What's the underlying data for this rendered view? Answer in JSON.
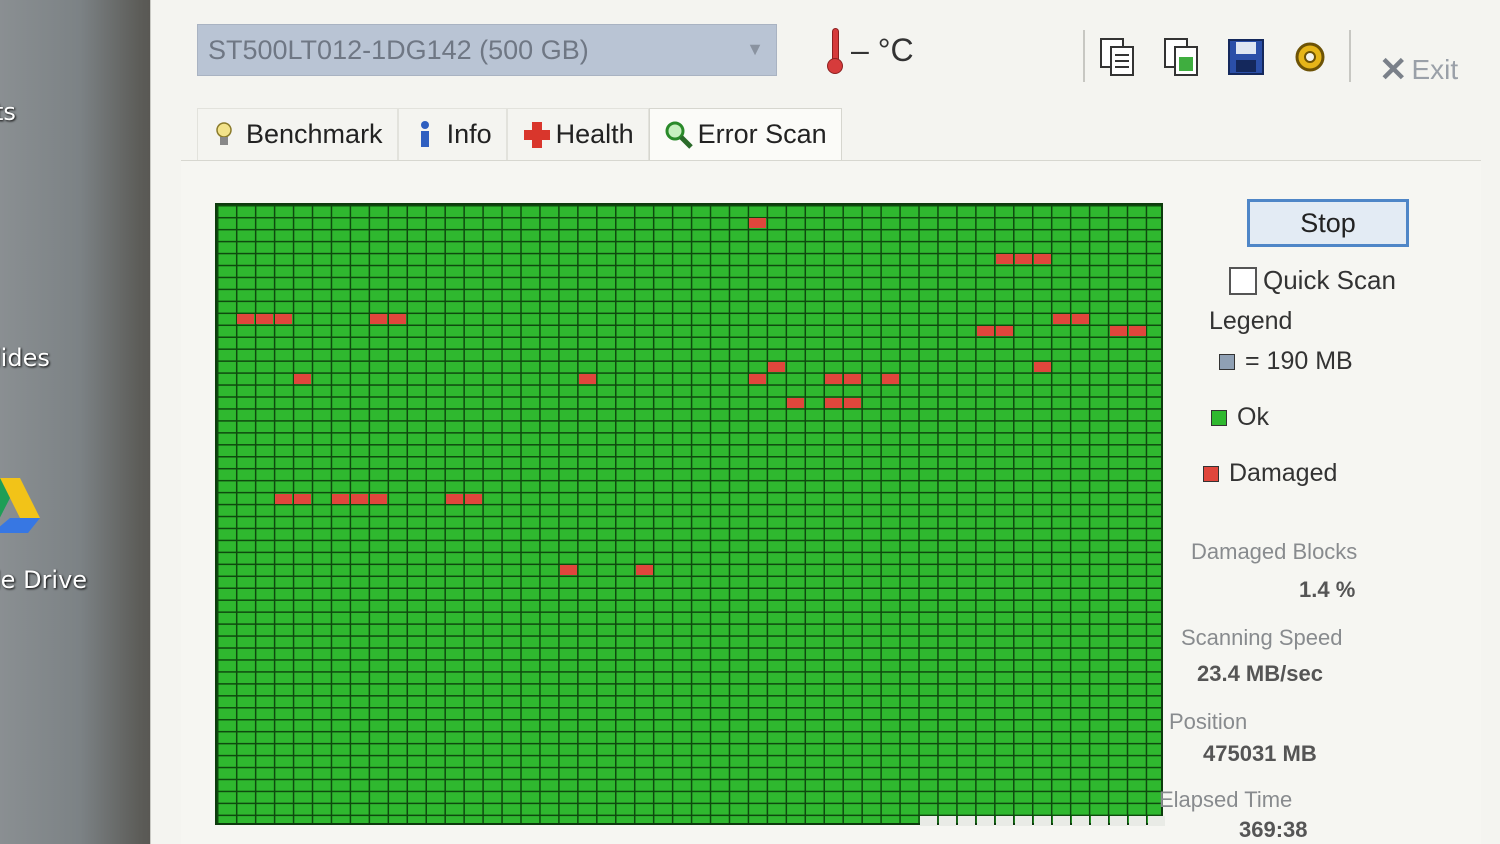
{
  "desktop": {
    "labels": [
      "ts",
      "lides",
      "le Drive"
    ]
  },
  "toolbar": {
    "drive": "ST500LT012-1DG142 (500 GB)",
    "temperature": "– °C",
    "exit_label": "Exit",
    "buttons": [
      "copy-text-icon",
      "copy-image-icon",
      "save-icon",
      "options-icon"
    ]
  },
  "tabs": [
    {
      "label": "Benchmark",
      "icon": "lightbulb-icon"
    },
    {
      "label": "Info",
      "icon": "info-icon"
    },
    {
      "label": "Health",
      "icon": "health-cross-icon"
    },
    {
      "label": "Error Scan",
      "icon": "magnifier-icon"
    }
  ],
  "scan": {
    "stop_label": "Stop",
    "quick_scan_label": "Quick Scan",
    "quick_scan_checked": false,
    "legend_title": "Legend",
    "legend_block": "= 190 MB",
    "legend_ok": "Ok",
    "legend_damaged": "Damaged",
    "damaged_blocks_label": "Damaged Blocks",
    "damaged_blocks_value": "1.4 %",
    "scanning_speed_label": "Scanning Speed",
    "scanning_speed_value": "23.4 MB/sec",
    "position_label": "Position",
    "position_value": "475031 MB",
    "elapsed_label": "Elapsed Time",
    "elapsed_value": "369:38",
    "grid": {
      "cols": 50,
      "rows": 52
    },
    "damaged_cells": [
      [
        28,
        1
      ],
      [
        41,
        4
      ],
      [
        42,
        4
      ],
      [
        43,
        4
      ],
      [
        1,
        9
      ],
      [
        2,
        9
      ],
      [
        3,
        9
      ],
      [
        8,
        9
      ],
      [
        9,
        9
      ],
      [
        44,
        9
      ],
      [
        45,
        9
      ],
      [
        40,
        10
      ],
      [
        41,
        10
      ],
      [
        47,
        10
      ],
      [
        48,
        10
      ],
      [
        4,
        14
      ],
      [
        19,
        14
      ],
      [
        28,
        14
      ],
      [
        29,
        13
      ],
      [
        32,
        14
      ],
      [
        33,
        14
      ],
      [
        35,
        14
      ],
      [
        43,
        13
      ],
      [
        30,
        16
      ],
      [
        32,
        16
      ],
      [
        33,
        16
      ],
      [
        3,
        24
      ],
      [
        4,
        24
      ],
      [
        6,
        24
      ],
      [
        7,
        24
      ],
      [
        8,
        24
      ],
      [
        12,
        24
      ],
      [
        13,
        24
      ],
      [
        18,
        30
      ],
      [
        22,
        30
      ]
    ],
    "unscanned_cells": [
      [
        37,
        51
      ],
      [
        38,
        51
      ],
      [
        39,
        51
      ],
      [
        40,
        51
      ],
      [
        41,
        51
      ],
      [
        42,
        51
      ],
      [
        43,
        51
      ],
      [
        44,
        51
      ],
      [
        45,
        51
      ],
      [
        46,
        51
      ],
      [
        47,
        51
      ],
      [
        48,
        51
      ],
      [
        49,
        51
      ]
    ]
  }
}
